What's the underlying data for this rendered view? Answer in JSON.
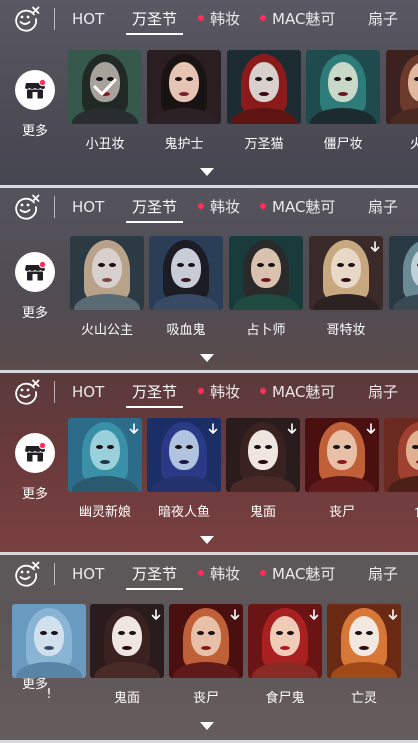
{
  "colors": {
    "accent_dot": "#ff2e5c",
    "tab_text": "#ffffff",
    "panel1_bg": "#4e4c55",
    "panel2_bg": "#4f4c53",
    "panel3_bg": "#6a3a3b",
    "panel4_bg": "#5e5658"
  },
  "panels": [
    {
      "tabs": [
        {
          "label": "HOT",
          "icon": "none",
          "active": false
        },
        {
          "label": "万圣节",
          "icon": "none",
          "active": true
        },
        {
          "label": "韩妆",
          "icon": "dot",
          "active": false
        },
        {
          "label": "MAC魅可",
          "icon": "dot",
          "active": false
        },
        {
          "label": "扇子",
          "icon": "none",
          "active": false
        }
      ],
      "more_label": "更多",
      "items": [
        {
          "label": "小丑妆",
          "selected": true,
          "download": false
        },
        {
          "label": "鬼护士",
          "selected": false,
          "download": false
        },
        {
          "label": "万圣猫",
          "selected": false,
          "download": false
        },
        {
          "label": "僵尸妆",
          "selected": false,
          "download": false
        },
        {
          "label": "火山",
          "selected": false,
          "download": false
        }
      ]
    },
    {
      "tabs": [
        {
          "label": "HOT",
          "icon": "none",
          "active": false
        },
        {
          "label": "万圣节",
          "icon": "none",
          "active": true
        },
        {
          "label": "韩妆",
          "icon": "dot",
          "active": false
        },
        {
          "label": "MAC魅可",
          "icon": "dot",
          "active": false
        },
        {
          "label": "扇子",
          "icon": "none",
          "active": false
        }
      ],
      "more_label": "更多",
      "items": [
        {
          "label": "火山公主",
          "selected": false,
          "download": false
        },
        {
          "label": "吸血鬼",
          "selected": false,
          "download": false
        },
        {
          "label": "占卜师",
          "selected": false,
          "download": false
        },
        {
          "label": "哥特妆",
          "selected": false,
          "download": true
        },
        {
          "label": "幽",
          "selected": false,
          "download": false
        }
      ]
    },
    {
      "tabs": [
        {
          "label": "HOT",
          "icon": "none",
          "active": false
        },
        {
          "label": "万圣节",
          "icon": "none",
          "active": true
        },
        {
          "label": "韩妆",
          "icon": "dot",
          "active": false
        },
        {
          "label": "MAC魅可",
          "icon": "dot",
          "active": false
        },
        {
          "label": "扇子",
          "icon": "none",
          "active": false
        }
      ],
      "more_label": "更多",
      "items": [
        {
          "label": "幽灵新娘",
          "selected": false,
          "download": true
        },
        {
          "label": "暗夜人鱼",
          "selected": false,
          "download": true
        },
        {
          "label": "鬼面",
          "selected": false,
          "download": true
        },
        {
          "label": "丧尸",
          "selected": false,
          "download": true
        },
        {
          "label": "食",
          "selected": false,
          "download": false
        }
      ]
    },
    {
      "tabs": [
        {
          "label": "HOT",
          "icon": "none",
          "active": false
        },
        {
          "label": "万圣节",
          "icon": "none",
          "active": true
        },
        {
          "label": "韩妆",
          "icon": "dot",
          "active": false
        },
        {
          "label": "MAC魅可",
          "icon": "dot",
          "active": false
        },
        {
          "label": "扇子",
          "icon": "none",
          "active": false
        }
      ],
      "more_label": "更多",
      "items": [
        {
          "label": "!",
          "selected": false,
          "download": false
        },
        {
          "label": "鬼面",
          "selected": false,
          "download": true
        },
        {
          "label": "丧尸",
          "selected": false,
          "download": true
        },
        {
          "label": "食尸鬼",
          "selected": false,
          "download": true
        },
        {
          "label": "亡灵",
          "selected": false,
          "download": true
        }
      ]
    }
  ]
}
